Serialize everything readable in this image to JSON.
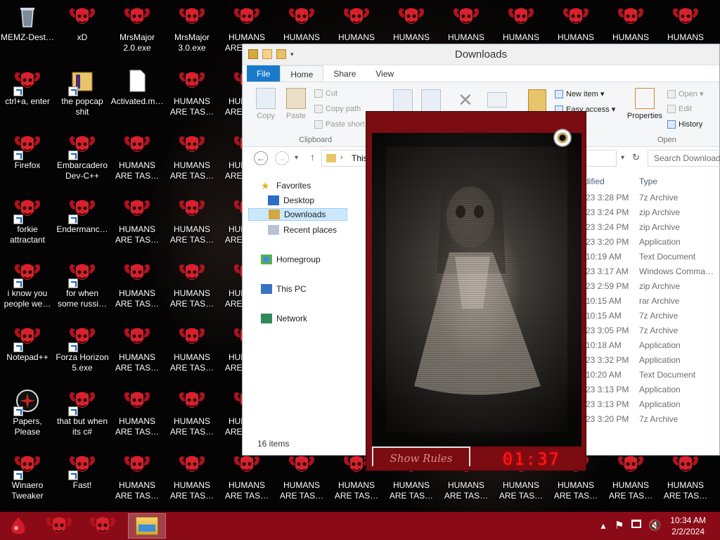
{
  "desktop": {
    "icons": [
      {
        "label": "MEMZ-Dest…",
        "icon": "recycle-bin-icon"
      },
      {
        "label": "xD",
        "icon": "ram-skull-icon"
      },
      {
        "label": "MrsMajor 2.0.exe",
        "icon": "ram-skull-icon"
      },
      {
        "label": "MrsMajor 3.0.exe",
        "icon": "ram-skull-icon"
      },
      {
        "label": "HUMANS ARE TAS…",
        "icon": "ram-skull-icon"
      },
      {
        "label": "HUMANS ARE TAS…",
        "icon": "ram-skull-icon"
      },
      {
        "label": "HUMANS ARE TAS…",
        "icon": "ram-skull-icon"
      },
      {
        "label": "HUMANS ARE TAS…",
        "icon": "ram-skull-icon"
      },
      {
        "label": "HUMANS ARE TAS…",
        "icon": "ram-skull-icon"
      },
      {
        "label": "HUMANS ARE TAS…",
        "icon": "ram-skull-icon"
      },
      {
        "label": "HUMANS ARE TAS…",
        "icon": "ram-skull-icon"
      },
      {
        "label": "HUMANS ARE TAS…",
        "icon": "ram-skull-icon"
      },
      {
        "label": "HUMANS ARE TAS…",
        "icon": "ram-skull-icon"
      },
      {
        "label": "ctrl+a, enter",
        "icon": "ram-skull-icon"
      },
      {
        "label": "the popcap shit",
        "icon": "folder-icon"
      },
      {
        "label": "Activated.m…",
        "icon": "document-icon"
      },
      {
        "label": "HUMANS ARE TAS…",
        "icon": "ram-skull-icon"
      },
      {
        "label": "HUMANS ARE TAS…",
        "icon": "ram-skull-icon"
      },
      {
        "label": "Firefox",
        "icon": "ram-skull-icon"
      },
      {
        "label": "Embarcadero Dev-C++",
        "icon": "ram-skull-icon"
      },
      {
        "label": "HUMANS ARE TAS…",
        "icon": "ram-skull-icon"
      },
      {
        "label": "HUMANS ARE TAS…",
        "icon": "ram-skull-icon"
      },
      {
        "label": "HUMANS ARE TAS…",
        "icon": "ram-skull-icon"
      },
      {
        "label": "forkie attractant",
        "icon": "ram-skull-icon"
      },
      {
        "label": "Endermanc…",
        "icon": "ram-skull-icon"
      },
      {
        "label": "HUMANS ARE TAS…",
        "icon": "ram-skull-icon"
      },
      {
        "label": "HUMANS ARE TAS…",
        "icon": "ram-skull-icon"
      },
      {
        "label": "HUMANS ARE TAS…",
        "icon": "ram-skull-icon"
      },
      {
        "label": "i know you people we…",
        "icon": "ram-skull-icon"
      },
      {
        "label": "for when some russi…",
        "icon": "ram-skull-icon"
      },
      {
        "label": "HUMANS ARE TAS…",
        "icon": "ram-skull-icon"
      },
      {
        "label": "HUMANS ARE TAS…",
        "icon": "ram-skull-icon"
      },
      {
        "label": "HUMANS ARE TAS…",
        "icon": "ram-skull-icon"
      },
      {
        "label": "Notepad++",
        "icon": "ram-skull-icon"
      },
      {
        "label": "Forza Horizon 5.exe",
        "icon": "ram-skull-icon"
      },
      {
        "label": "HUMANS ARE TAS…",
        "icon": "ram-skull-icon"
      },
      {
        "label": "HUMANS ARE TAS…",
        "icon": "ram-skull-icon"
      },
      {
        "label": "HUMANS ARE TAS…",
        "icon": "ram-skull-icon"
      },
      {
        "label": "Papers, Please",
        "icon": "papers-please-icon"
      },
      {
        "label": "that but when its c#",
        "icon": "ram-skull-icon"
      },
      {
        "label": "HUMANS ARE TAS…",
        "icon": "ram-skull-icon"
      },
      {
        "label": "HUMANS ARE TAS…",
        "icon": "ram-skull-icon"
      },
      {
        "label": "HUMANS ARE TAS…",
        "icon": "ram-skull-icon"
      },
      {
        "label": "Winaero Tweaker",
        "icon": "ram-skull-icon"
      },
      {
        "label": "Fast!",
        "icon": "ram-skull-icon"
      },
      {
        "label": "HUMANS ARE TAS…",
        "icon": "ram-skull-icon"
      },
      {
        "label": "HUMANS ARE TAS…",
        "icon": "ram-skull-icon"
      },
      {
        "label": "HUMANS ARE TAS…",
        "icon": "ram-skull-icon"
      },
      {
        "label": "HUMANS ARE TAS…",
        "icon": "ram-skull-icon"
      },
      {
        "label": "HUMANS ARE TAS…",
        "icon": "ram-skull-icon"
      },
      {
        "label": "HUMANS ARE TAS…",
        "icon": "ram-skull-icon"
      },
      {
        "label": "HUMANS ARE TAS…",
        "icon": "ram-skull-icon"
      },
      {
        "label": "HUMANS ARE TAS…",
        "icon": "ram-skull-icon"
      },
      {
        "label": "HUMANS ARE TAS…",
        "icon": "ram-skull-icon"
      },
      {
        "label": "HUMANS ARE TAS…",
        "icon": "ram-skull-icon"
      },
      {
        "label": "HUMANS ARE TAS…",
        "icon": "ram-skull-icon"
      }
    ]
  },
  "explorer": {
    "title": "Downloads",
    "tabs": {
      "file": "File",
      "home": "Home",
      "share": "Share",
      "view": "View"
    },
    "ribbon": {
      "copy": "Copy",
      "paste": "Paste",
      "cut": "Cut",
      "copy_path": "Copy path",
      "paste_shortcut": "Paste short",
      "clipboard_group": "Clipboard",
      "new_item": "New item ▾",
      "easy_access": "Easy access ▾",
      "properties": "Properties",
      "open": "Open ▾",
      "edit": "Edit",
      "history": "History",
      "open_group": "Open"
    },
    "address": {
      "crumb": "This",
      "search_placeholder": "Search Downloads"
    },
    "nav": {
      "favorites": "Favorites",
      "desktop": "Desktop",
      "downloads": "Downloads",
      "recent": "Recent places",
      "homegroup": "Homegroup",
      "this_pc": "This PC",
      "network": "Network"
    },
    "columns": {
      "modified": "dified",
      "type": "Type"
    },
    "rows": [
      {
        "modified": "23 3:28 PM",
        "type": "7z Archive"
      },
      {
        "modified": "23 3:24 PM",
        "type": "zip Archive"
      },
      {
        "modified": "23 3:24 PM",
        "type": "zip Archive"
      },
      {
        "modified": "23 3:20 PM",
        "type": "Application"
      },
      {
        "modified": "10:19 AM",
        "type": "Text Document"
      },
      {
        "modified": "23 3:17 AM",
        "type": "Windows Comma…"
      },
      {
        "modified": "23 2:59 PM",
        "type": "zip Archive"
      },
      {
        "modified": "10:15 AM",
        "type": "rar Archive"
      },
      {
        "modified": "10:15 AM",
        "type": "7z Archive"
      },
      {
        "modified": "23 3:05 PM",
        "type": "7z Archive"
      },
      {
        "modified": "10:18 AM",
        "type": "Application"
      },
      {
        "modified": "23 3:32 PM",
        "type": "Application"
      },
      {
        "modified": "10:20 AM",
        "type": "Text Document"
      },
      {
        "modified": "23 3:13 PM",
        "type": "Application"
      },
      {
        "modified": "23 3:13 PM",
        "type": "Application"
      },
      {
        "modified": "23 3:20 PM",
        "type": "7z Archive"
      }
    ],
    "status": "16 items"
  },
  "scare_overlay": {
    "rules_button": "Show Rules",
    "timer": "01:37",
    "accent": "#7a0c12",
    "timer_color": "#ff1a1a"
  },
  "taskbar": {
    "color": "#8a0b17",
    "items": [
      "start-icon",
      "ram-skull-icon",
      "ram-skull-icon",
      "file-explorer-icon"
    ],
    "clock_time": "10:34 AM",
    "clock_date": "2/2/2024",
    "tray": [
      "show-hidden-icons-icon",
      "action-center-flag-icon",
      "network-icon",
      "volume-muted-icon"
    ]
  }
}
